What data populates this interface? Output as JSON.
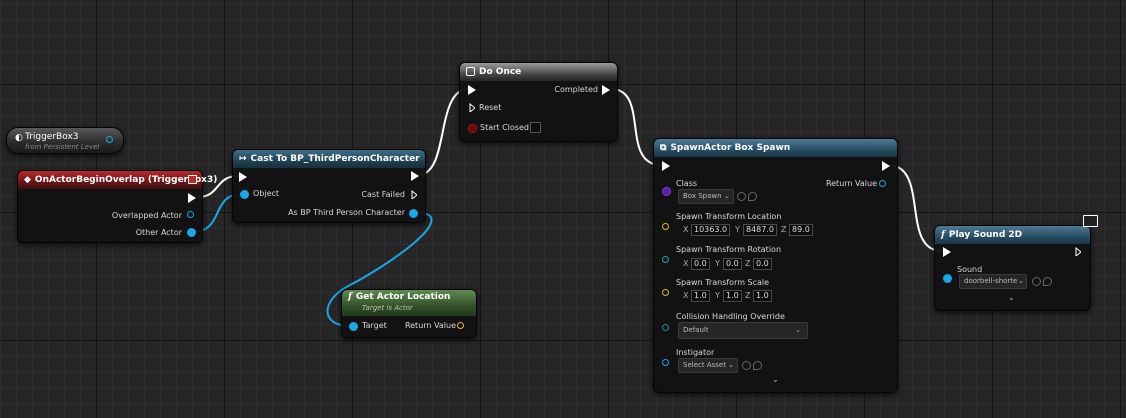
{
  "nodes": {
    "trigger_ref": {
      "title": "TriggerBox3",
      "subtitle": "from Persistent Level"
    },
    "event": {
      "title": "OnActorBeginOverlap (TriggerBox3)",
      "pins": {
        "overlapped": "Overlapped Actor",
        "other": "Other Actor"
      }
    },
    "cast": {
      "title": "Cast To BP_ThirdPersonCharacter",
      "pins": {
        "object": "Object",
        "cast_failed": "Cast Failed",
        "as_char": "As BP Third Person Character"
      }
    },
    "do_once": {
      "title": "Do Once",
      "pins": {
        "completed": "Completed",
        "reset": "Reset",
        "start_closed": "Start Closed"
      }
    },
    "get_loc": {
      "title": "Get Actor Location",
      "subtitle": "Target is Actor",
      "pins": {
        "target": "Target",
        "return": "Return Value"
      }
    },
    "spawn": {
      "title": "SpawnActor Box Spawn",
      "pins": {
        "class": "Class",
        "class_value": "Box Spawn",
        "return": "Return Value",
        "location": "Spawn Transform Location",
        "rotation": "Spawn Transform Rotation",
        "scale": "Spawn Transform Scale",
        "collision": "Collision Handling Override",
        "collision_value": "Default",
        "instigator": "Instigator",
        "instigator_value": "Select Asset"
      },
      "loc": {
        "x": "10363.0",
        "y": "8487.0",
        "z": "89.0"
      },
      "rot": {
        "x": "0.0",
        "y": "0.0",
        "z": "0.0"
      },
      "scl": {
        "x": "1.0",
        "y": "1.0",
        "z": "1.0"
      },
      "axes": {
        "x": "X",
        "y": "Y",
        "z": "Z"
      }
    },
    "play_sound": {
      "title": "Play Sound 2D",
      "pins": {
        "sound": "Sound",
        "sound_value": "doorbell-shorter"
      }
    }
  },
  "icons": {
    "event": "event-diamond-icon",
    "cast": "cast-arrow-icon",
    "function": "function-f-icon",
    "spawn": "spawn-actor-icon",
    "monitor": "monitor-icon"
  },
  "colors": {
    "exec_wire": "#ffffff",
    "object_wire": "#1aa6e8",
    "event_header": "#b8282c",
    "cast_header": "#3e6f88",
    "pure_header": "#5f8a4e"
  }
}
